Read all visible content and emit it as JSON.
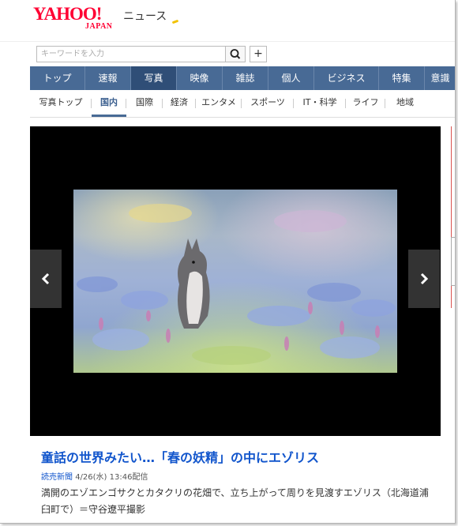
{
  "header": {
    "logo_text": "YAHOO!",
    "logo_sub": "JAPAN",
    "section_title": "ニュース"
  },
  "search": {
    "placeholder": "キーワードを入力",
    "plus_label": "+"
  },
  "main_nav": [
    {
      "label": "トップ",
      "active": false
    },
    {
      "label": "速報",
      "active": false
    },
    {
      "label": "写真",
      "active": true
    },
    {
      "label": "映像",
      "active": false
    },
    {
      "label": "雑誌",
      "active": false
    },
    {
      "label": "個人",
      "active": false
    },
    {
      "label": "ビジネス",
      "active": false
    },
    {
      "label": "特集",
      "active": false
    },
    {
      "label": "意識",
      "active": false
    }
  ],
  "sub_nav": [
    {
      "label": "写真トップ",
      "active": false
    },
    {
      "label": "国内",
      "active": true
    },
    {
      "label": "国際",
      "active": false
    },
    {
      "label": "経済",
      "active": false
    },
    {
      "label": "エンタメ",
      "active": false
    },
    {
      "label": "スポーツ",
      "active": false
    },
    {
      "label": "IT・科学",
      "active": false
    },
    {
      "label": "ライフ",
      "active": false
    },
    {
      "label": "地域",
      "active": false
    }
  ],
  "gallery": {
    "prev_icon": "chevron-left-icon",
    "next_icon": "chevron-right-icon"
  },
  "article": {
    "headline": "童話の世界みたい…「春の妖精」の中にエゾリス",
    "source": "読売新聞",
    "date": "4/26(水) 13:46配信",
    "caption": "満開のエゾエンゴサクとカタクリの花畑で、立ち上がって周りを見渡すエゾリス（北海道浦臼町で）＝守谷遼平撮影"
  },
  "colors": {
    "brand_red": "#ff0033",
    "nav_blue": "#486a95",
    "nav_active": "#2f4e77",
    "link_blue": "#1155cc"
  }
}
